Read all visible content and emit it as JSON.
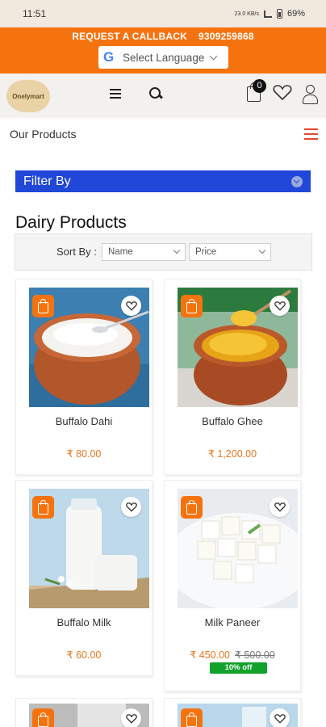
{
  "status": {
    "time": "11:51",
    "net": "23.0 KB/s",
    "battery": "69%"
  },
  "topbar": {
    "callback_label": "REQUEST A CALLBACK",
    "phone": "9309259868",
    "language_label": "Select Language",
    "bg": "#f5730f"
  },
  "header": {
    "logo_text": "Onelymart",
    "cart_count": "0"
  },
  "nav": {
    "title": "Our Products"
  },
  "filter": {
    "label": "Filter By",
    "bg": "#2147d8"
  },
  "category": {
    "title": "Dairy Products"
  },
  "sort": {
    "label": "Sort By :",
    "name_select": "Name",
    "price_select": "Price"
  },
  "products": [
    {
      "name": "Buffalo Dahi",
      "price": "₹ 80.00",
      "old_price": "",
      "discount": ""
    },
    {
      "name": "Buffalo Ghee",
      "price": "₹ 1,200.00",
      "old_price": "",
      "discount": ""
    },
    {
      "name": "Buffalo Milk",
      "price": "₹ 60.00",
      "old_price": "",
      "discount": ""
    },
    {
      "name": "Milk Paneer",
      "price": "₹ 450.00",
      "old_price": "₹ 500.00",
      "discount": "10% off"
    }
  ],
  "colors": {
    "accent": "#f5730f",
    "price": "#e8781f",
    "discount": "#12a12b"
  }
}
